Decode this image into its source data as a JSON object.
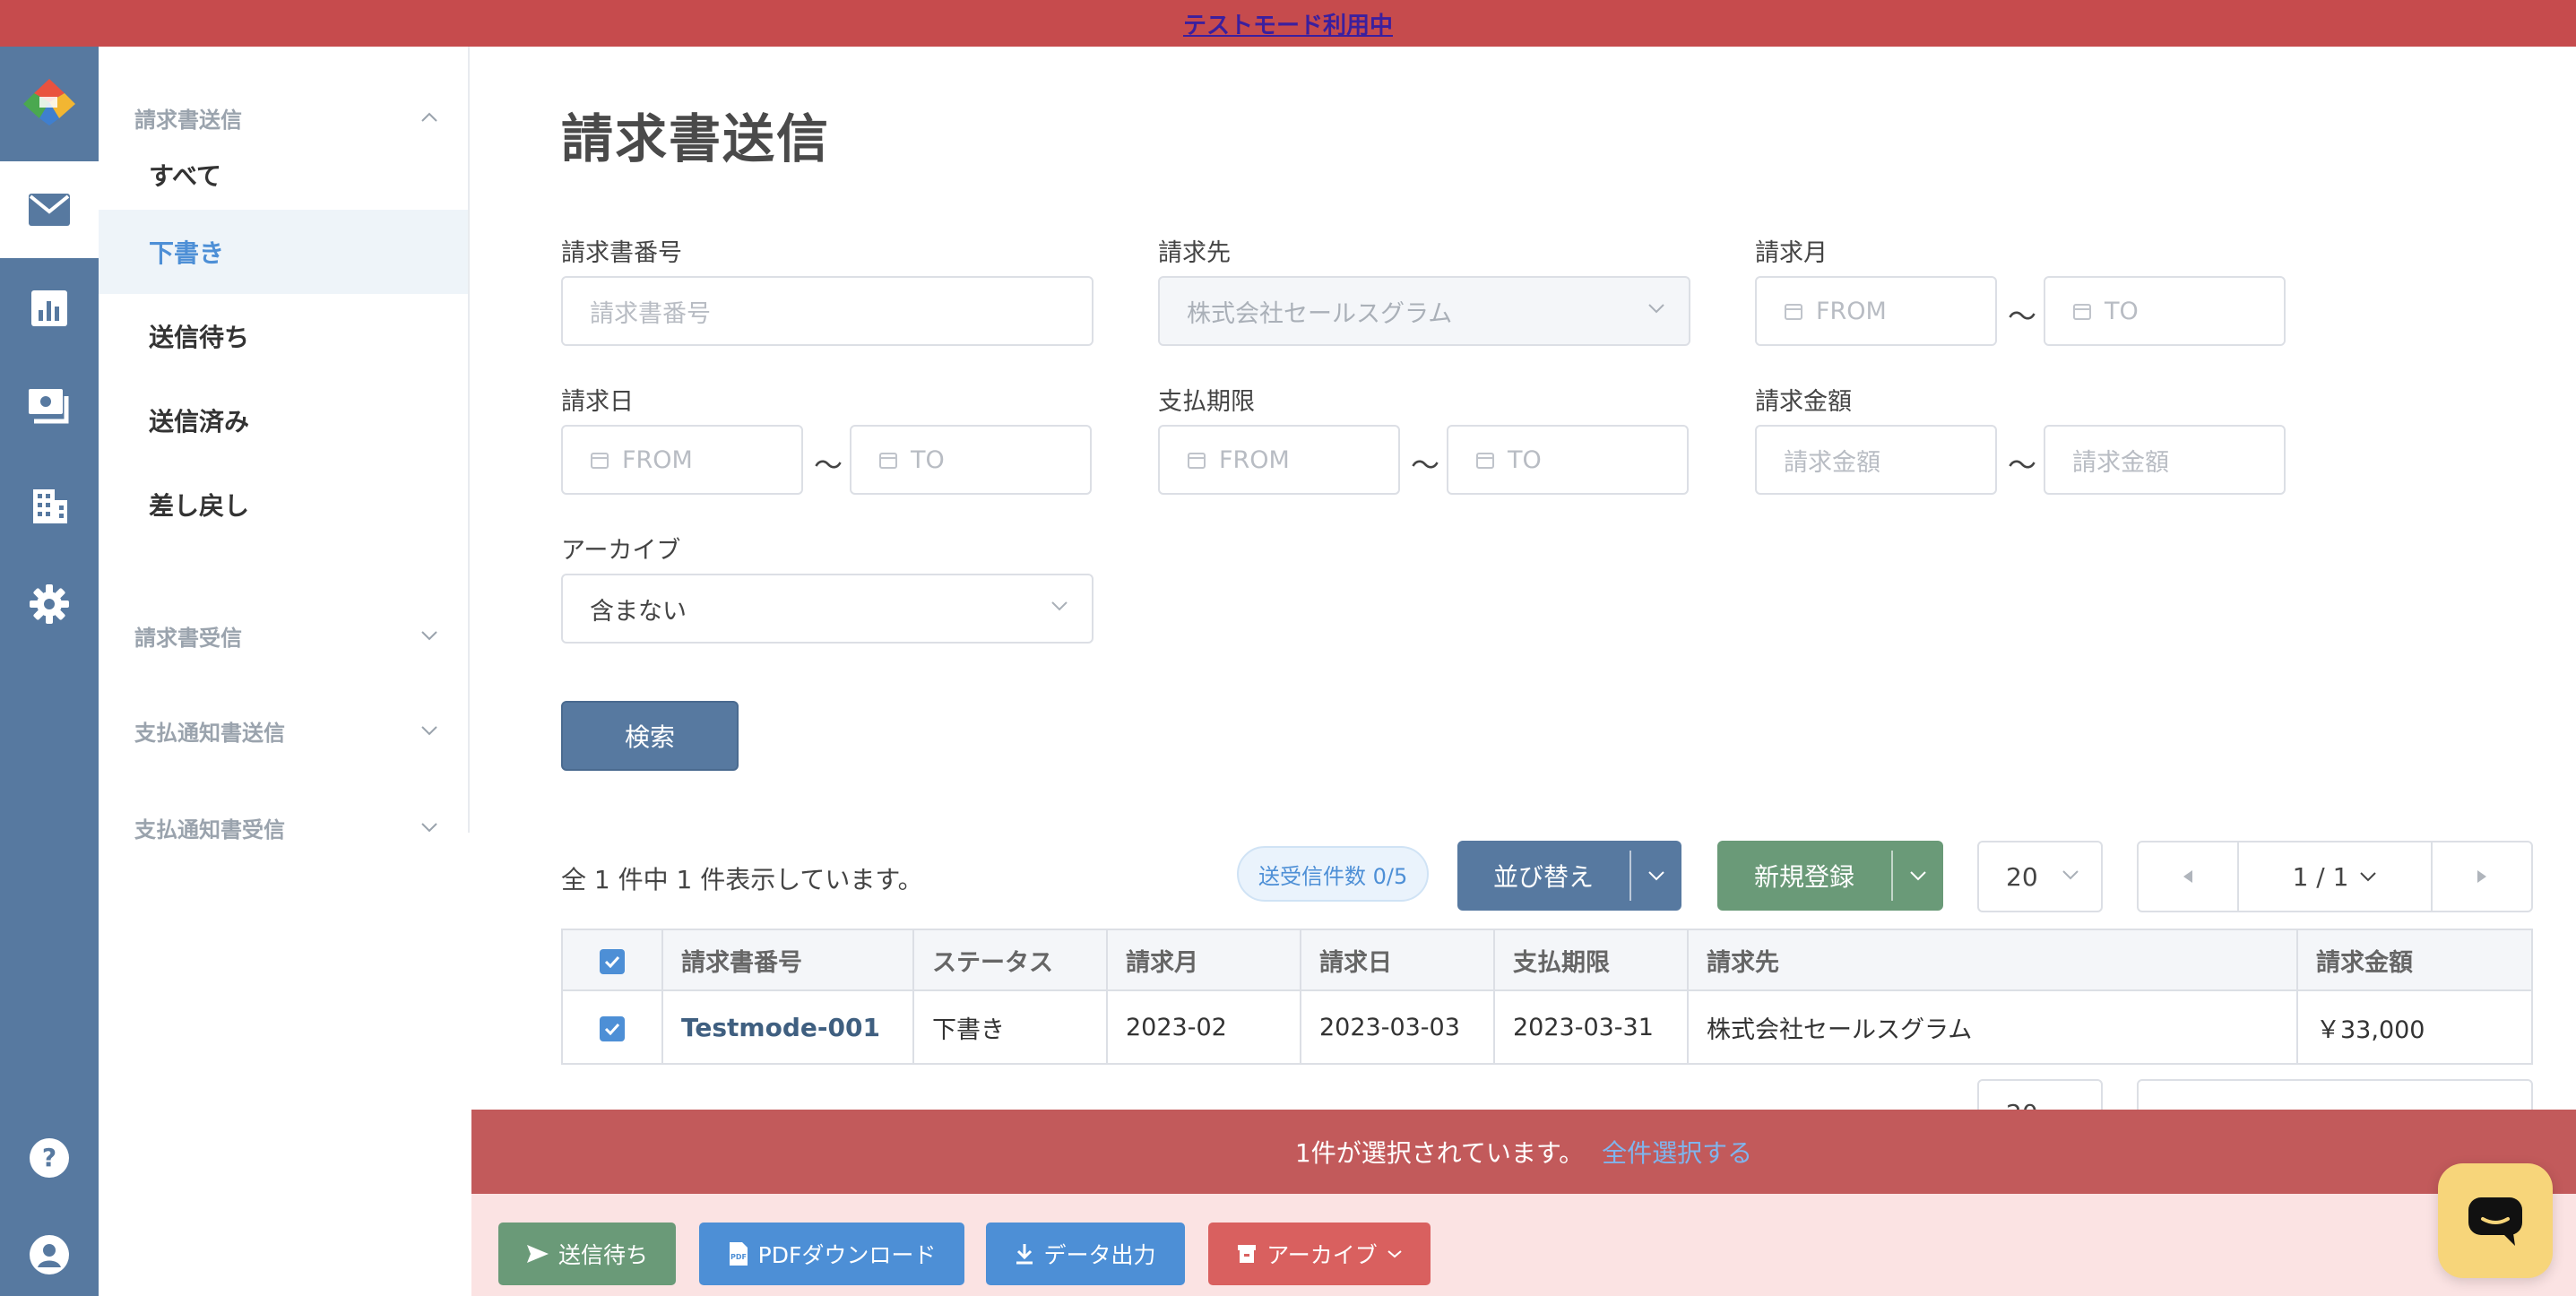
{
  "banner": {
    "text": "テストモード利用中"
  },
  "sidebar": {
    "groups": [
      {
        "label": "請求書送信"
      },
      {
        "label": "請求書受信"
      },
      {
        "label": "支払通知書送信"
      },
      {
        "label": "支払通知書受信"
      }
    ],
    "items": [
      {
        "label": "すべて"
      },
      {
        "label": "下書き"
      },
      {
        "label": "送信待ち"
      },
      {
        "label": "送信済み"
      },
      {
        "label": "差し戻し"
      }
    ]
  },
  "page": {
    "title": "請求書送信"
  },
  "filters": {
    "invoice_number": {
      "label": "請求書番号",
      "placeholder": "請求書番号"
    },
    "recipient": {
      "label": "請求先",
      "value": "株式会社セールスグラム"
    },
    "invoice_month": {
      "label": "請求月",
      "from": "FROM",
      "to": "TO"
    },
    "invoice_date": {
      "label": "請求日",
      "from": "FROM",
      "to": "TO"
    },
    "due_date": {
      "label": "支払期限",
      "from": "FROM",
      "to": "TO"
    },
    "amount": {
      "label": "請求金額",
      "from": "請求金額",
      "to": "請求金額"
    },
    "archive": {
      "label": "アーカイブ",
      "value": "含まない"
    },
    "tilde": "〜",
    "search_label": "検索"
  },
  "results": {
    "count_text": "全 1 件中 1 件表示しています。",
    "send_count": "送受信件数 0/5",
    "sort_label": "並び替え",
    "new_label": "新規登録",
    "per_page": "20",
    "page_info": "1 / 1",
    "columns": [
      "請求書番号",
      "ステータス",
      "請求月",
      "請求日",
      "支払期限",
      "請求先",
      "請求金額"
    ],
    "rows": [
      {
        "number": "Testmode-001",
        "status": "下書き",
        "month": "2023-02",
        "date": "2023-03-03",
        "due": "2023-03-31",
        "recipient": "株式会社セールスグラム",
        "amount": "￥33,000"
      }
    ]
  },
  "selection": {
    "message": "1件が選択されています。",
    "select_all": "全件選択する"
  },
  "actions": {
    "send_wait": "送信待ち",
    "pdf_download": "PDFダウンロード",
    "data_export": "データ出力",
    "archive": "アーカイブ"
  },
  "colors": {
    "banner": "#c64b4d",
    "rail": "#5779a0",
    "accent_blue": "#4d8fd6",
    "green": "#6a9a78",
    "red": "#d9605f"
  }
}
